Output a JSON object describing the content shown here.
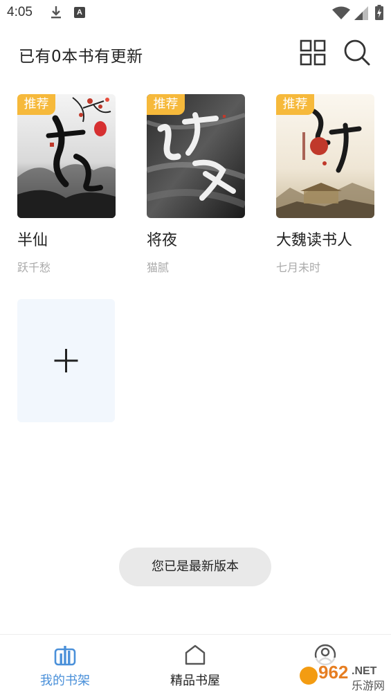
{
  "status_bar": {
    "time": "4:05",
    "notification_letter": "A",
    "icons": [
      "download-icon",
      "font-app-icon",
      "wifi-icon",
      "signal-icon",
      "battery-icon"
    ]
  },
  "header": {
    "title": "已有0本书有更新",
    "actions": [
      "grid-view-icon",
      "search-icon"
    ]
  },
  "books": [
    {
      "badge": "推荐",
      "title": "半仙",
      "author": "跃千愁"
    },
    {
      "badge": "推荐",
      "title": "将夜",
      "author": "猫腻"
    },
    {
      "badge": "推荐",
      "title": "大魏读书人",
      "author": "七月未时"
    }
  ],
  "add_card": {
    "icon": "plus-icon"
  },
  "toast": {
    "message": "您已是最新版本"
  },
  "bottom_nav": {
    "items": [
      {
        "label": "我的书架",
        "icon": "bookshelf-icon",
        "active": true
      },
      {
        "label": "精品书屋",
        "icon": "home-icon",
        "active": false
      },
      {
        "label": "",
        "icon": "user-icon",
        "active": false
      }
    ]
  },
  "watermark": {
    "number": "962",
    "dot_net": ".NET",
    "name": "乐游网"
  },
  "colors": {
    "accent": "#4a90d9",
    "badge": "#f6b93b",
    "add_card_bg": "#f2f7fd",
    "toast_bg": "#e9e9e9"
  }
}
